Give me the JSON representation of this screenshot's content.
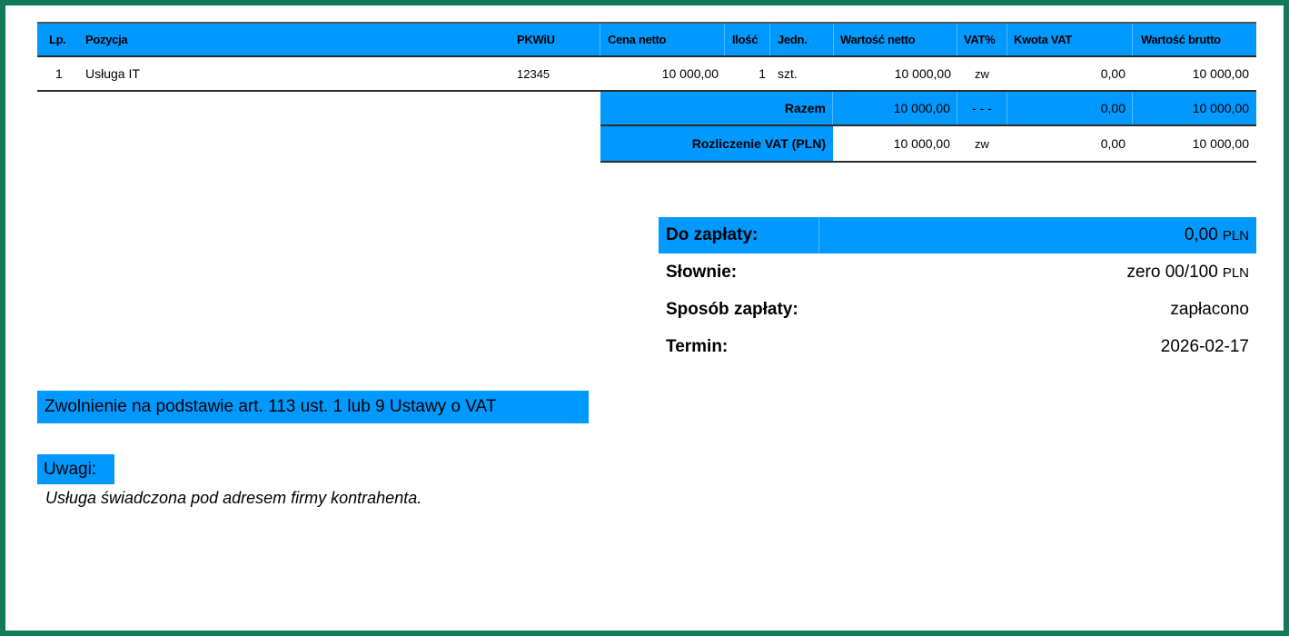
{
  "table": {
    "headers": {
      "lp": "Lp.",
      "pozycja": "Pozycja",
      "pkwiu": "PKWiU",
      "cena_netto": "Cena netto",
      "ilosc": "Ilość",
      "jedn": "Jedn.",
      "wartosc_netto": "Wartość netto",
      "vat_pct": "VAT%",
      "kwota_vat": "Kwota VAT",
      "wartosc_brutto": "Wartość brutto"
    },
    "rows": [
      {
        "lp": "1",
        "pozycja": "Usługa IT",
        "pkwiu": "12345",
        "cena_netto": "10 000,00",
        "ilosc": "1",
        "jedn": "szt.",
        "wartosc_netto": "10 000,00",
        "vat_pct": "zw",
        "kwota_vat": "0,00",
        "wartosc_brutto": "10 000,00"
      }
    ]
  },
  "totals": {
    "razem": {
      "label": "Razem",
      "wartosc_netto": "10 000,00",
      "vat_pct": "- - -",
      "kwota_vat": "0,00",
      "wartosc_brutto": "10 000,00"
    },
    "rozliczenie": {
      "label": "Rozliczenie VAT (PLN)",
      "wartosc_netto": "10 000,00",
      "vat_pct": "zw",
      "kwota_vat": "0,00",
      "wartosc_brutto": "10 000,00"
    }
  },
  "payment": {
    "do_zaplaty_label": "Do zapłaty:",
    "do_zaplaty_value": "0,00",
    "currency": "PLN",
    "slownie_label": "Słownie:",
    "slownie_value": "zero 00/100",
    "sposob_label": "Sposób zapłaty:",
    "sposob_value": "zapłacono",
    "termin_label": "Termin:",
    "termin_value": "2026-02-17"
  },
  "exemption": "Zwolnienie na podstawie art. 113 ust. 1 lub 9 Ustawy o VAT",
  "notes": {
    "label": "Uwagi:",
    "text": "Usługa świadczona pod adresem firmy kontrahenta."
  },
  "colors": {
    "accent": "#0099ff",
    "frame": "#117a5a"
  }
}
